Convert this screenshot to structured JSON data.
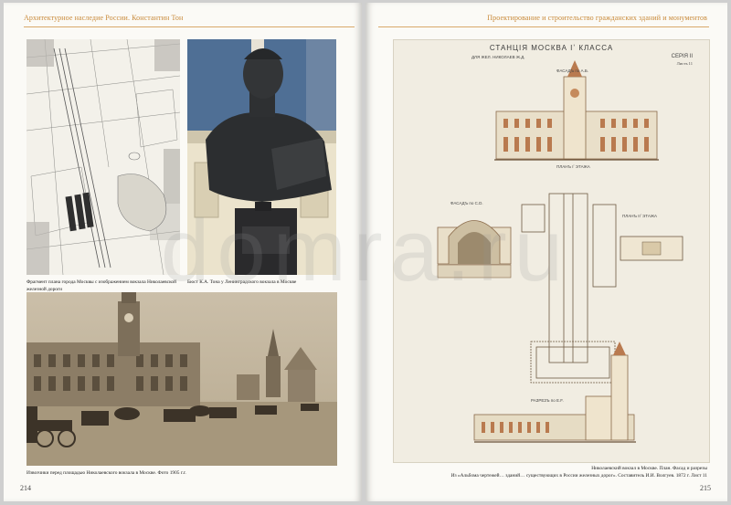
{
  "left_page": {
    "running_head": "Архитектурное наследие России. Константин Тон",
    "page_number": "214",
    "figures": {
      "map": {
        "caption": "Фрагмент плана города Москвы с изображением вокзала Николаевской железной дороги"
      },
      "bust": {
        "caption": "Бюст К.А. Тона у Ленинградского вокзала в Москве"
      },
      "square_photo": {
        "caption": "Извозчики перед площадью Николаевского вокзала в Москве. Фото 1905 г.г."
      }
    }
  },
  "right_page": {
    "running_head": "Проектирование и строительство гражданских зданий и монументов",
    "page_number": "215",
    "drawing": {
      "title": "СТАНЦІЯ МОСКВА Iʼ КЛАССА",
      "subtitle_left": "ДЛЯ ЖЕЛ. НИКОЛАЕВ Ж.Д.",
      "series": "СЕРІЯ II",
      "sheet": "Листъ 11",
      "facade_label": "ФАСАДЪ по А.Б.",
      "plan_label_1": "ПЛАНЪ Iʼ ЭТАЖА",
      "facade_cd_label": "ФАСАДЪ по С.D.",
      "plan_label_2": "ПЛАНЪ IIʼ ЭТАЖА",
      "section_label": "РАЗРЕЗЪ по Е.F."
    },
    "caption_line1": "Николаевский вокзал в Москве. План. Фасад и разрезы",
    "caption_line2": "Из «Альбома чертежей… зданий… существующих в России железных дорог». Составитель И.И. Волгуев. 1872 г. Лист 11"
  },
  "watermark": "domra.ru",
  "colors": {
    "accent": "#c98a3a",
    "paper": "#fbfaf6"
  }
}
